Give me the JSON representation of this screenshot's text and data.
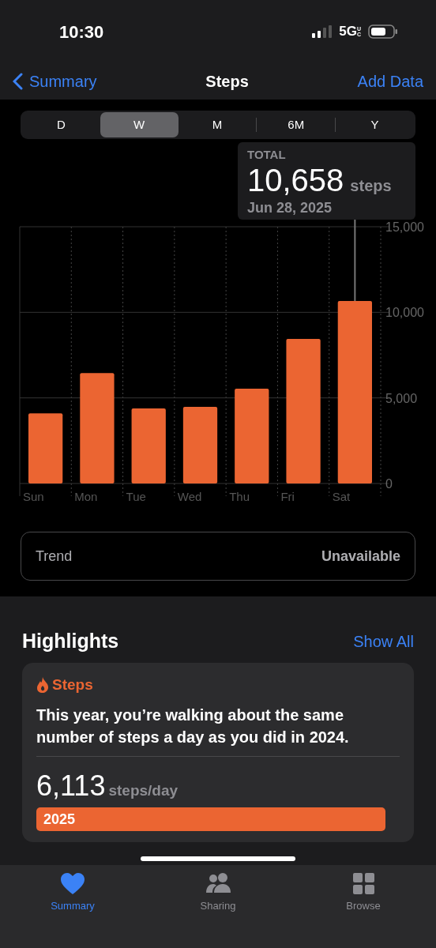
{
  "status_bar": {
    "time": "10:30",
    "network": "5G",
    "network_suffix": "UC"
  },
  "nav": {
    "back": "Summary",
    "title": "Steps",
    "action": "Add Data"
  },
  "ranges": [
    {
      "label": "D",
      "selected": false
    },
    {
      "label": "W",
      "selected": true
    },
    {
      "label": "M",
      "selected": false
    },
    {
      "label": "6M",
      "selected": false
    },
    {
      "label": "Y",
      "selected": false
    }
  ],
  "tooltip": {
    "label": "TOTAL",
    "value": "10,658",
    "unit": "steps",
    "date": "Jun 28, 2025"
  },
  "chart": {
    "chart_data": {
      "type": "bar",
      "categories": [
        "Sun",
        "Mon",
        "Tue",
        "Wed",
        "Thu",
        "Fri",
        "Sat"
      ],
      "series": [
        {
          "color": "#eb6532",
          "values": [
            4100,
            6450,
            4380,
            4480,
            5540,
            8450,
            10658
          ]
        }
      ],
      "ylim": [
        0,
        15000
      ],
      "yticks": [
        {
          "value": 0,
          "label": "0"
        },
        {
          "value": 5000,
          "label": "5,000"
        },
        {
          "value": 10000,
          "label": "10,000"
        },
        {
          "value": 15000,
          "label": "15,000"
        }
      ]
    }
  },
  "trend": {
    "label": "Trend",
    "value": "Unavailable"
  },
  "highlights": {
    "title": "Highlights",
    "link": "Show All",
    "card": {
      "category": "Steps",
      "text": "This year, you’re walking about the same number of steps a day as you did in 2024.",
      "comparisons": [
        {
          "value": "6,113",
          "unit": "steps/day",
          "year": "2025"
        }
      ]
    }
  },
  "tab_bar": [
    {
      "label": "Summary",
      "selected": true
    },
    {
      "label": "Sharing",
      "selected": false
    },
    {
      "label": "Browse",
      "selected": false
    }
  ]
}
